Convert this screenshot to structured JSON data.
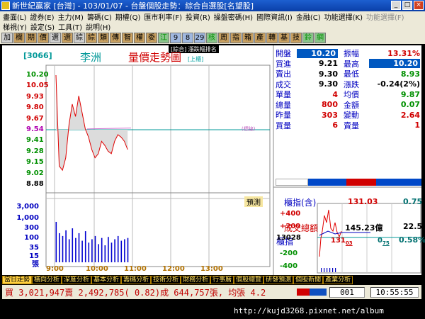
{
  "window": {
    "title": "新世紀贏家 [台灣] - 103/01/07 - 台盤個股走勢：綜合自選股[名望股]"
  },
  "menu": {
    "row1": [
      "畫面(L)",
      "證券(E)",
      "主力(M)",
      "籌碼(C)",
      "期權(Q)",
      "匯市利率(F)",
      "投資(R)",
      "操盤密碼(H)",
      "國際資訊(I)",
      "金融(C)",
      "功能選擇(K)"
    ],
    "row1_dim": "功能選擇(F)",
    "row2": [
      "梯視(Y)",
      "設定(S)",
      "工具(T)",
      "說明(H)"
    ]
  },
  "toolbar": [
    "加",
    "欄",
    "期",
    "價",
    "選",
    "選",
    "綜",
    "綜",
    "類",
    "傳",
    "智",
    "權",
    "委",
    "江",
    "9",
    "8",
    "29",
    "核",
    "周",
    "指",
    "箱",
    "產",
    "轉",
    "基",
    "技",
    "鈴",
    "網"
  ],
  "header": {
    "code": "[3066]",
    "name": "李洲",
    "title": "量價走勢圖",
    "tag": "[上櫃]",
    "popup": "[綜合] 漲跌幅排名",
    "ref_label": "(標線)"
  },
  "price_axis": [
    "10.20",
    "10.05",
    "9.93",
    "9.80",
    "9.67",
    "9.54",
    "9.41",
    "9.28",
    "9.15",
    "9.02",
    "8.88"
  ],
  "volume_axis": [
    "3,000",
    "1,000",
    "300",
    "100",
    "35",
    "15",
    "張"
  ],
  "time_axis": [
    "9:00",
    "10:00",
    "11:00",
    "12:00",
    "13:00"
  ],
  "predict_button": "預測",
  "quotes": [
    {
      "l1": "開盤",
      "v1": "10.20",
      "l2": "振幅",
      "v2": "13.31%"
    },
    {
      "l1": "買進",
      "v1": "9.21",
      "l2": "最高",
      "v2": "10.20"
    },
    {
      "l1": "賣出",
      "v1": "9.30",
      "l2": "最低",
      "v2": "8.93"
    },
    {
      "l1": "成交",
      "v1": "9.30",
      "l2": "漲跌",
      "v2": "-0.24(2%)"
    },
    {
      "l1": "單量",
      "v1": "4",
      "l2": "均價",
      "v2": "9.87"
    },
    {
      "l1": "總量",
      "v1": "800",
      "l2": "金額",
      "v2": "0.07"
    },
    {
      "l1": "昨量",
      "v1": "303",
      "l2": "變動",
      "v2": "2.64"
    },
    {
      "l1": "買量",
      "v1": "6",
      "l2": "賣量",
      "v2": "1"
    }
  ],
  "index_panel": {
    "label": "櫃指(含)",
    "value": "131.03",
    "change": "0.75",
    "total_label": "成交總額",
    "total_value": "145.23億",
    "total_change": "22.5"
  },
  "mini_chart": {
    "label": "櫃指",
    "value": "131",
    "value_sub": "03",
    "change": "0",
    "change_sub": "75",
    "pct": "0.58%",
    "axis": [
      "+400",
      "+200",
      "13028",
      "-200",
      "-400"
    ]
  },
  "bottom_tabs": [
    "當日走勢",
    "橫向分析",
    "深度分析",
    "基本分析",
    "籌碼分析",
    "技術分析",
    "財務分析",
    "行事曆",
    "個股總覽",
    "研發預測",
    "個股新聞",
    "產業分析"
  ],
  "status": {
    "text": "買 3,021,947賣 2,492,785( 0.82)成 644,757張, 均張 4.2",
    "count": "001",
    "clock": "10:55:55"
  },
  "watermark": "http://kujd3268.pixnet.net/album",
  "chart_data": {
    "type": "line",
    "x": [
      "9:00",
      "9:05",
      "9:10",
      "9:15",
      "9:20",
      "9:25",
      "9:30",
      "9:35",
      "9:40",
      "9:45",
      "9:50",
      "9:55",
      "10:00",
      "10:05",
      "10:10",
      "10:15",
      "10:20",
      "10:25",
      "10:30",
      "10:35",
      "10:40",
      "10:45",
      "10:50"
    ],
    "series": [
      {
        "values": [
          10.2,
          9.1,
          9.05,
          9.2,
          9.6,
          9.85,
          9.7,
          9.95,
          9.75,
          9.55,
          9.45,
          9.3,
          9.2,
          9.25,
          9.4,
          9.35,
          9.28,
          9.25,
          9.4,
          9.48,
          9.45,
          9.4,
          9.3
        ]
      }
    ],
    "volume": [
      300,
      60,
      40,
      90,
      25,
      120,
      30,
      60,
      20,
      80,
      15,
      25,
      40,
      12,
      30,
      10,
      35,
      15,
      25,
      40,
      20,
      25,
      30
    ],
    "ref_line": 9.54,
    "ylim": [
      8.88,
      10.2
    ]
  }
}
